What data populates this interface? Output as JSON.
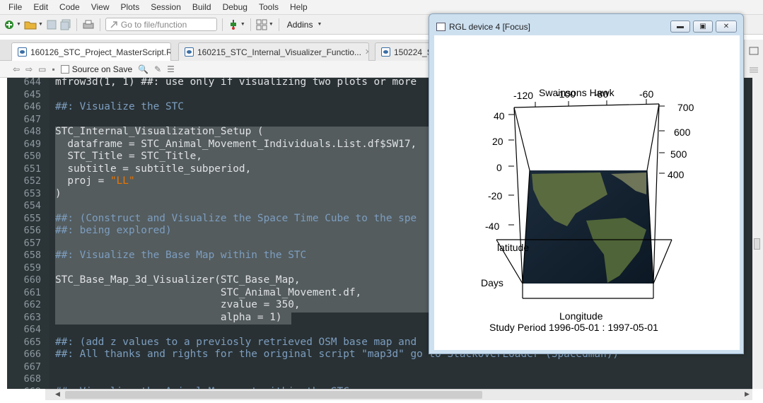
{
  "menu": [
    "File",
    "Edit",
    "Code",
    "View",
    "Plots",
    "Session",
    "Build",
    "Debug",
    "Tools",
    "Help"
  ],
  "toolbar": {
    "goto_placeholder": "Go to file/function",
    "addins_label": "Addins"
  },
  "tabs": [
    {
      "label": "160126_STC_Project_MasterScript.R",
      "active": true
    },
    {
      "label": "160215_STC_Internal_Visualizer_Functio...",
      "active": false
    },
    {
      "label": "150224_S",
      "active": false
    }
  ],
  "editor_toolbar": {
    "source_on_save": "Source on Save"
  },
  "code_lines": [
    {
      "num": "644",
      "text": "mfrow3d(1, 1) ##: use only if visualizing two plots or more"
    },
    {
      "num": "645",
      "text": ""
    },
    {
      "num": "646",
      "text": "##: Visualize the STC"
    },
    {
      "num": "647",
      "text": ""
    },
    {
      "num": "648",
      "text": "STC_Internal_Visualization_Setup ("
    },
    {
      "num": "649",
      "text": "  dataframe = STC_Animal_Movement_Individuals.List.df$SW17,"
    },
    {
      "num": "650",
      "text": "  STC_Title = STC_Title,"
    },
    {
      "num": "651",
      "text": "  subtitle = subtitle_subperiod,"
    },
    {
      "num": "652",
      "text": "  proj = \"LL\""
    },
    {
      "num": "653",
      "text": ")"
    },
    {
      "num": "654",
      "text": ""
    },
    {
      "num": "655",
      "text": "##: (Construct and Visualize the Space Time Cube to the spe"
    },
    {
      "num": "656",
      "text": "##: being explored)"
    },
    {
      "num": "657",
      "text": ""
    },
    {
      "num": "658",
      "text": "##: Visualize the Base Map within the STC"
    },
    {
      "num": "659",
      "text": ""
    },
    {
      "num": "660",
      "text": "STC_Base_Map_3d_Visualizer(STC_Base_Map,"
    },
    {
      "num": "661",
      "text": "                           STC_Animal_Movement.df,"
    },
    {
      "num": "662",
      "text": "                           zvalue = 350,"
    },
    {
      "num": "663",
      "text": "                           alpha = 1)"
    },
    {
      "num": "664",
      "text": ""
    },
    {
      "num": "665",
      "text": "##: (add z values to a previosly retrieved OSM base map and"
    },
    {
      "num": "666",
      "text": "##: All thanks and rights for the original script \"map3d\" go to StackOverLoader (Spacedman))"
    },
    {
      "num": "667",
      "text": ""
    },
    {
      "num": "668",
      "text": ""
    },
    {
      "num": "669",
      "text": "##: Visualize the Animal Movement within the STC"
    }
  ],
  "rgl": {
    "title": "RGL device 4 [Focus]",
    "plot_title": "Swainsons Hawk",
    "x_ticks": [
      "-120",
      "-100",
      "-80",
      "-60"
    ],
    "y_ticks": [
      "40",
      "20",
      "0",
      "-20",
      "-40"
    ],
    "z_ticks": [
      "700",
      "600",
      "500",
      "400"
    ],
    "x_label": "Longitude",
    "y_label": "latitude",
    "z_label": "Days",
    "subtitle": "Study Period 1996-05-01 : 1997-05-01"
  },
  "colors": {
    "editor_bg": "#293134",
    "comment": "#7d9ec0",
    "string": "#ec7600",
    "selection": "#545c5e"
  }
}
